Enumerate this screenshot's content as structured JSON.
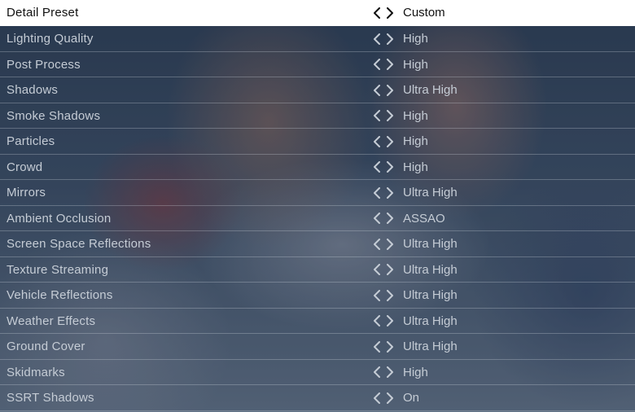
{
  "settings": [
    {
      "label": "Detail Preset",
      "value": "Custom",
      "selected": true
    },
    {
      "label": "Lighting Quality",
      "value": "High"
    },
    {
      "label": "Post Process",
      "value": "High"
    },
    {
      "label": "Shadows",
      "value": "Ultra High"
    },
    {
      "label": "Smoke Shadows",
      "value": "High"
    },
    {
      "label": "Particles",
      "value": "High"
    },
    {
      "label": "Crowd",
      "value": "High"
    },
    {
      "label": "Mirrors",
      "value": "Ultra High"
    },
    {
      "label": "Ambient Occlusion",
      "value": "ASSAO"
    },
    {
      "label": "Screen Space Reflections",
      "value": "Ultra High"
    },
    {
      "label": "Texture Streaming",
      "value": "Ultra High"
    },
    {
      "label": "Vehicle Reflections",
      "value": "Ultra High"
    },
    {
      "label": "Weather Effects",
      "value": "Ultra High"
    },
    {
      "label": "Ground Cover",
      "value": "Ultra High"
    },
    {
      "label": "Skidmarks",
      "value": "High"
    },
    {
      "label": "SSRT Shadows",
      "value": "On"
    }
  ],
  "icons": {
    "prev": "chevron-left-icon",
    "next": "chevron-right-icon"
  },
  "colors": {
    "selected_bg": "#ffffff",
    "selected_text": "#111111",
    "text": "#c5ccd5"
  }
}
